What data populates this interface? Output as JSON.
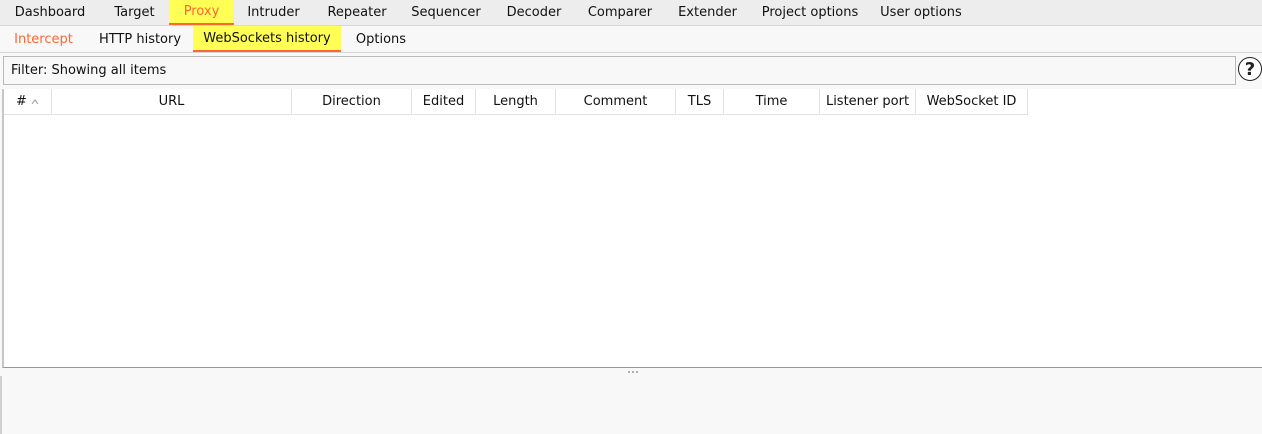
{
  "top_tabs": [
    {
      "label": "Dashboard",
      "active": false
    },
    {
      "label": "Target",
      "active": false
    },
    {
      "label": "Proxy",
      "active": true
    },
    {
      "label": "Intruder",
      "active": false
    },
    {
      "label": "Repeater",
      "active": false
    },
    {
      "label": "Sequencer",
      "active": false
    },
    {
      "label": "Decoder",
      "active": false
    },
    {
      "label": "Comparer",
      "active": false
    },
    {
      "label": "Extender",
      "active": false
    },
    {
      "label": "Project options",
      "active": false
    },
    {
      "label": "User options",
      "active": false
    }
  ],
  "sub_tabs": [
    {
      "label": "Intercept",
      "active": false
    },
    {
      "label": "HTTP history",
      "active": false
    },
    {
      "label": "WebSockets history",
      "active": true
    },
    {
      "label": "Options",
      "active": false
    }
  ],
  "filter": {
    "text": "Filter: Showing all items"
  },
  "help_icon": {
    "glyph": "?"
  },
  "table": {
    "columns": [
      {
        "label": "#"
      },
      {
        "label": "URL"
      },
      {
        "label": "Direction"
      },
      {
        "label": "Edited"
      },
      {
        "label": "Length"
      },
      {
        "label": "Comment"
      },
      {
        "label": "TLS"
      },
      {
        "label": "Time"
      },
      {
        "label": "Listener port"
      },
      {
        "label": "WebSocket ID"
      }
    ],
    "rows": []
  },
  "colors": {
    "accent": "#ff6633",
    "highlight": "#ffff55"
  }
}
